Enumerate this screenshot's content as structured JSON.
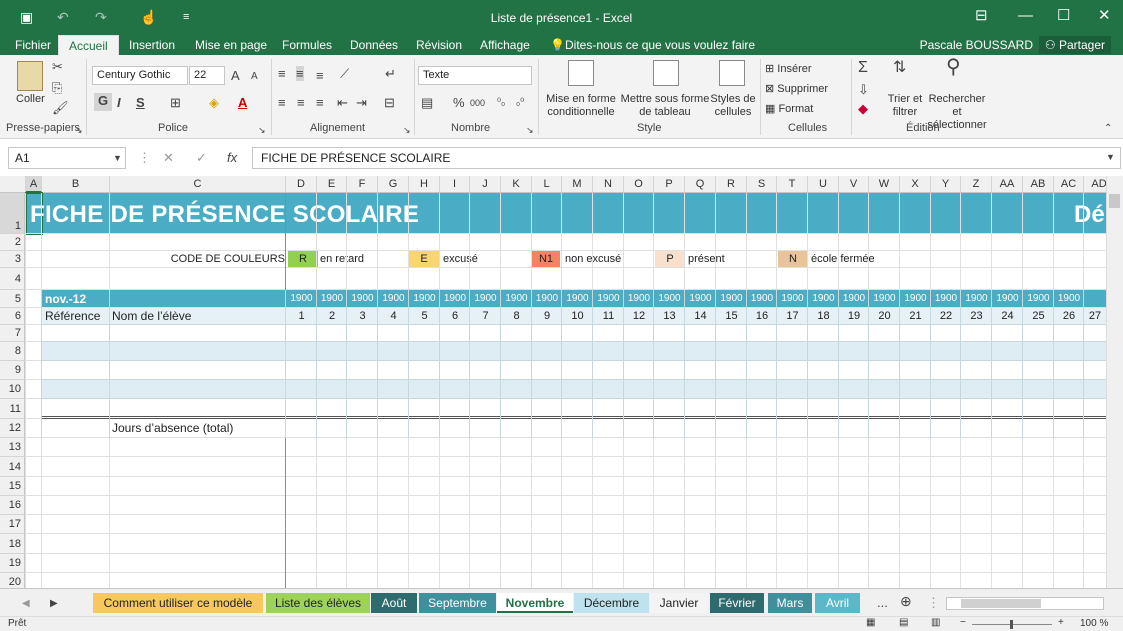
{
  "window": {
    "title": "Liste de présence1 - Excel",
    "controls": [
      "ribbon-display-icon",
      "minimize-icon",
      "maximize-icon",
      "close-icon"
    ]
  },
  "quick_access": {
    "icons": [
      "save-icon",
      "undo-icon",
      "redo-icon",
      "touch-mode-icon",
      "customize-icon"
    ]
  },
  "ribbon_tabs": [
    "Fichier",
    "Accueil",
    "Insertion",
    "Mise en page",
    "Formules",
    "Données",
    "Révision",
    "Affichage"
  ],
  "active_tab": "Accueil",
  "tell_me": "Dites-nous ce que vous voulez faire",
  "user": "Pascale BOUSSARD",
  "share_label": "Partager",
  "ribbon": {
    "clipboard": {
      "paste_label": "Coller",
      "group_label": "Presse-papiers"
    },
    "font": {
      "name": "Century Gothic",
      "size": "22",
      "bold": "G",
      "italic": "I",
      "underline": "S",
      "group_label": "Police"
    },
    "alignment": {
      "group_label": "Alignement"
    },
    "number": {
      "format": "Texte",
      "percent": "%",
      "thousands": "000",
      "group_label": "Nombre"
    },
    "style": {
      "conditional": [
        "Mise en forme",
        "conditionnelle"
      ],
      "table": [
        "Mettre sous forme",
        "de tableau"
      ],
      "cell_styles": [
        "Styles de",
        "cellules"
      ],
      "group_label": "Style"
    },
    "cells": {
      "insert": "Insérer",
      "delete": "Supprimer",
      "format": "Format",
      "group_label": "Cellules"
    },
    "editing": {
      "sort": [
        "Trier et",
        "filtrer"
      ],
      "find": [
        "Rechercher et",
        "sélectionner"
      ],
      "group_label": "Édition"
    }
  },
  "formula_bar": {
    "name_box": "A1",
    "formula": "FICHE DE PRÉSENCE SCOLAIRE",
    "fx": "fx"
  },
  "columns": [
    "A",
    "B",
    "C",
    "D",
    "E",
    "F",
    "G",
    "H",
    "I",
    "J",
    "K",
    "L",
    "M",
    "N",
    "O",
    "P",
    "Q",
    "R",
    "S",
    "T",
    "U",
    "V",
    "W",
    "X",
    "Y",
    "Z",
    "AA",
    "AB",
    "AC",
    "AD"
  ],
  "rows": [
    "1",
    "2",
    "3",
    "4",
    "5",
    "6",
    "7",
    "8",
    "9",
    "10",
    "11",
    "12",
    "13",
    "14",
    "15",
    "16",
    "17",
    "18",
    "19",
    "20"
  ],
  "sheet": {
    "title": "FICHE DE PRÉSENCE SCOLAIRE",
    "title_right": "Dé",
    "legend_label": "CODE DE COULEURS",
    "legend": [
      {
        "code": "R",
        "label": "en retard",
        "color": "#92d050"
      },
      {
        "code": "E",
        "label": "excusé",
        "color": "#f9d56e"
      },
      {
        "code": "N1",
        "label": "non excusé",
        "color": "#f4845f"
      },
      {
        "code": "P",
        "label": "présent",
        "color": "#f8e0cc"
      },
      {
        "code": "N",
        "label": "école fermée",
        "color": "#e8c49a"
      }
    ],
    "month_label": "nov.-12",
    "year_values": [
      "1900",
      "1900",
      "1900",
      "1900",
      "1900",
      "1900",
      "1900",
      "1900",
      "1900",
      "1900",
      "1900",
      "1900",
      "1900",
      "1900",
      "1900",
      "1900",
      "1900",
      "1900",
      "1900",
      "1900",
      "1900",
      "1900",
      "1900",
      "1900",
      "1900",
      "1900"
    ],
    "header_ref": "Référence",
    "header_name": "Nom de l’élève",
    "day_numbers": [
      "1",
      "2",
      "3",
      "4",
      "5",
      "6",
      "7",
      "8",
      "9",
      "10",
      "11",
      "12",
      "13",
      "14",
      "15",
      "16",
      "17",
      "18",
      "19",
      "20",
      "21",
      "22",
      "23",
      "24",
      "25",
      "26",
      "27"
    ],
    "absence_total": "Jours d’absence (total)",
    "header_color": "#4bacc6",
    "band_color": "#deedf3"
  },
  "sheet_tabs": [
    {
      "label": "Comment utiliser ce modèle",
      "color": "#f6c85f"
    },
    {
      "label": "Liste des élèves",
      "color": "#9dd35a"
    },
    {
      "label": "Août",
      "color": "#2e6b6e"
    },
    {
      "label": "Septembre",
      "color": "#3f8f9c"
    },
    {
      "label": "Novembre",
      "color": "#ffffff",
      "active": true
    },
    {
      "label": "Décembre",
      "color": "#bfe3ee"
    },
    {
      "label": "Janvier",
      "color": "#f4f4f4"
    },
    {
      "label": "Février",
      "color": "#2e6b6e"
    },
    {
      "label": "Mars",
      "color": "#3f8f9c"
    },
    {
      "label": "Avril",
      "color": "#5bb8c9"
    }
  ],
  "sheet_more": "...",
  "status": {
    "ready": "Prêt",
    "zoom": "100 %"
  }
}
